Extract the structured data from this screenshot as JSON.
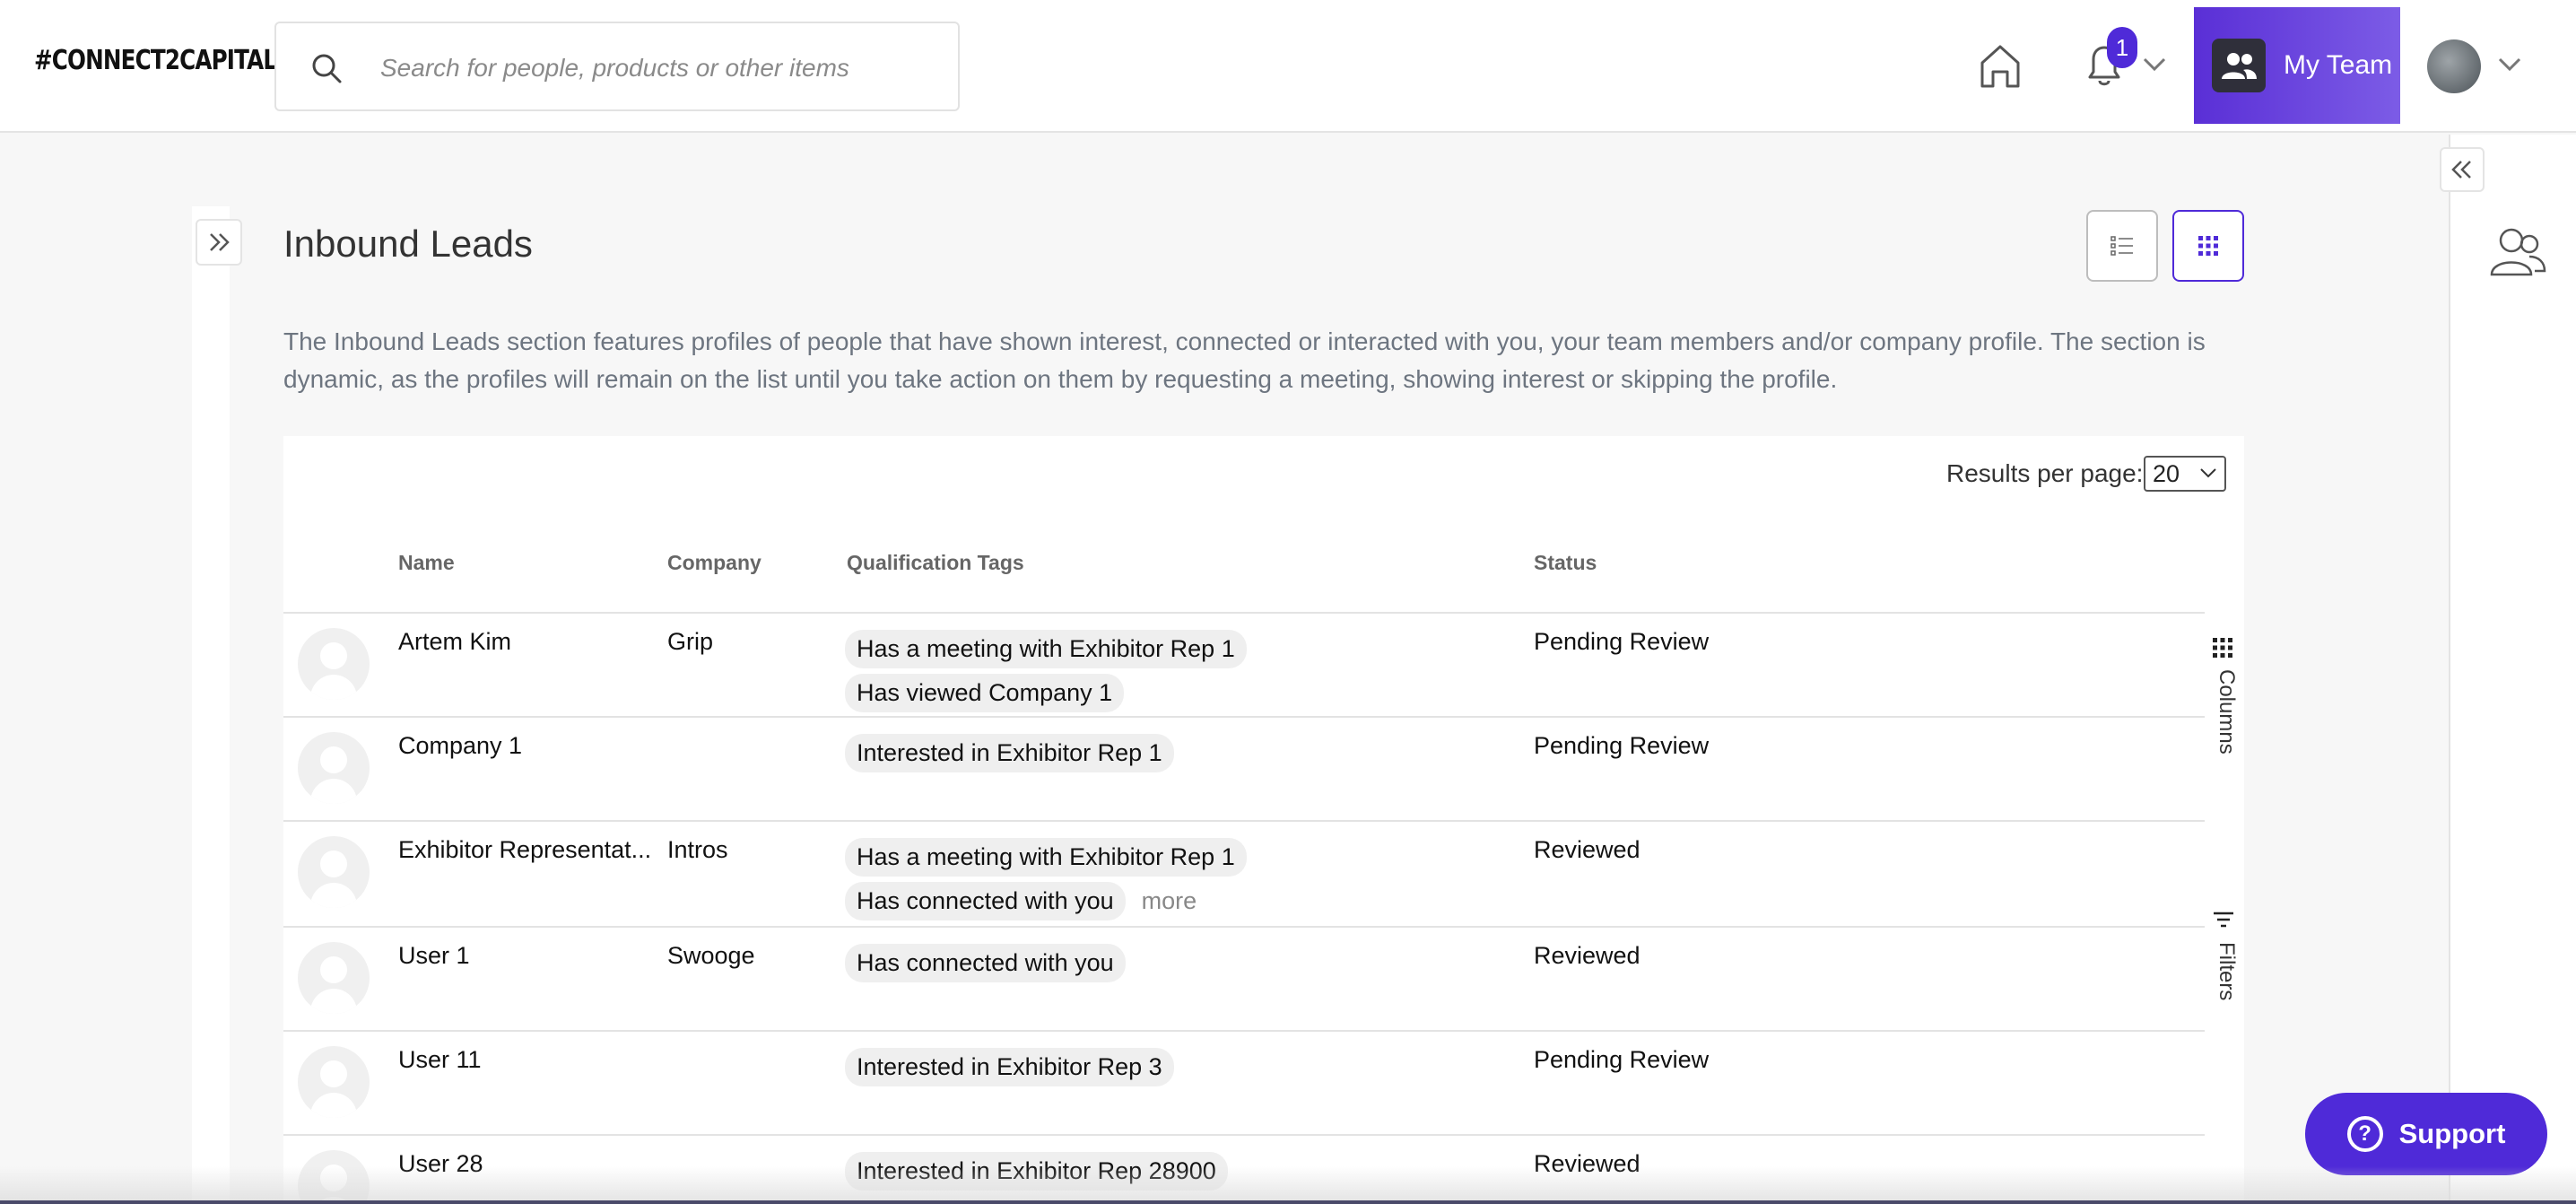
{
  "header": {
    "logo": "#CONNECT2CAPITAL",
    "search_placeholder": "Search for people, products or other items",
    "notification_count": "1",
    "my_team_label": "My Team"
  },
  "page": {
    "title": "Inbound Leads",
    "description": "The Inbound Leads section features profiles of people that have shown interest, connected or interacted with you, your team members and/or company profile. The section is dynamic, as the profiles will remain on the list until you take action on them by requesting a meeting, showing interest or skipping the profile."
  },
  "table": {
    "results_per_page_label": "Results per page:",
    "results_per_page_value": "20",
    "columns": [
      "Name",
      "Company",
      "Qualification Tags",
      "Status"
    ],
    "rows": [
      {
        "name": "Artem Kim",
        "company": "Grip",
        "tags": [
          "Has a meeting with Exhibitor Rep 1",
          "Has viewed Company 1"
        ],
        "more": "",
        "status": "Pending Review"
      },
      {
        "name": "Company 1",
        "company": "",
        "tags": [
          "Interested in Exhibitor Rep 1"
        ],
        "more": "",
        "status": "Pending Review"
      },
      {
        "name": "Exhibitor Representat...",
        "company": "Intros",
        "tags": [
          "Has a meeting with Exhibitor Rep 1",
          "Has connected with you"
        ],
        "more": "more",
        "status": "Reviewed"
      },
      {
        "name": "User 1",
        "company": "Swooge",
        "tags": [
          "Has connected with you"
        ],
        "more": "",
        "status": "Reviewed"
      },
      {
        "name": "User 11",
        "company": "",
        "tags": [
          "Interested in Exhibitor Rep 3"
        ],
        "more": "",
        "status": "Pending Review"
      },
      {
        "name": "User 28",
        "company": "",
        "tags": [
          "Interested in Exhibitor Rep 28900"
        ],
        "more": "",
        "status": "Reviewed"
      }
    ],
    "side_columns_label": "Columns",
    "side_filters_label": "Filters"
  },
  "support": {
    "label": "Support"
  },
  "colors": {
    "accent": "#4f2ad8",
    "accent_light": "#7c5ce6"
  }
}
